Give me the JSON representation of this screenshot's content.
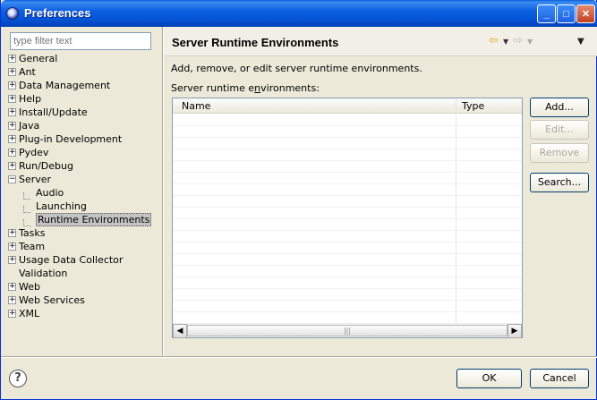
{
  "window": {
    "title": "Preferences"
  },
  "filter": {
    "placeholder": "type filter text"
  },
  "tree": {
    "items": [
      {
        "label": "General",
        "level": 0,
        "expander": "+"
      },
      {
        "label": "Ant",
        "level": 0,
        "expander": "+"
      },
      {
        "label": "Data Management",
        "level": 0,
        "expander": "+"
      },
      {
        "label": "Help",
        "level": 0,
        "expander": "+"
      },
      {
        "label": "Install/Update",
        "level": 0,
        "expander": "+"
      },
      {
        "label": "Java",
        "level": 0,
        "expander": "+"
      },
      {
        "label": "Plug-in Development",
        "level": 0,
        "expander": "+"
      },
      {
        "label": "Pydev",
        "level": 0,
        "expander": "+"
      },
      {
        "label": "Run/Debug",
        "level": 0,
        "expander": "+"
      },
      {
        "label": "Server",
        "level": 0,
        "expander": "−"
      },
      {
        "label": "Audio",
        "level": 1,
        "expander": ""
      },
      {
        "label": "Launching",
        "level": 1,
        "expander": ""
      },
      {
        "label": "Runtime Environments",
        "level": 1,
        "expander": "",
        "selected": true
      },
      {
        "label": "Tasks",
        "level": 0,
        "expander": "+"
      },
      {
        "label": "Team",
        "level": 0,
        "expander": "+"
      },
      {
        "label": "Usage Data Collector",
        "level": 0,
        "expander": "+"
      },
      {
        "label": "Validation",
        "level": 0,
        "expander": ""
      },
      {
        "label": "Web",
        "level": 0,
        "expander": "+"
      },
      {
        "label": "Web Services",
        "level": 0,
        "expander": "+"
      },
      {
        "label": "XML",
        "level": 0,
        "expander": "+"
      }
    ]
  },
  "page": {
    "title": "Server Runtime Environments",
    "description": "Add, remove, or edit server runtime environments.",
    "list_label_pre": "Server runtime e",
    "list_label_u": "n",
    "list_label_post": "vironments:"
  },
  "table": {
    "columns": [
      "Name",
      "Type"
    ],
    "rows": []
  },
  "buttons": {
    "add": "Add...",
    "edit": "Edit...",
    "remove": "Remove",
    "search": "Search...",
    "ok": "OK",
    "cancel": "Cancel"
  },
  "icons": {
    "back": "back-arrow-icon",
    "forward": "forward-arrow-icon",
    "menu": "view-menu-icon",
    "help": "help-icon"
  }
}
